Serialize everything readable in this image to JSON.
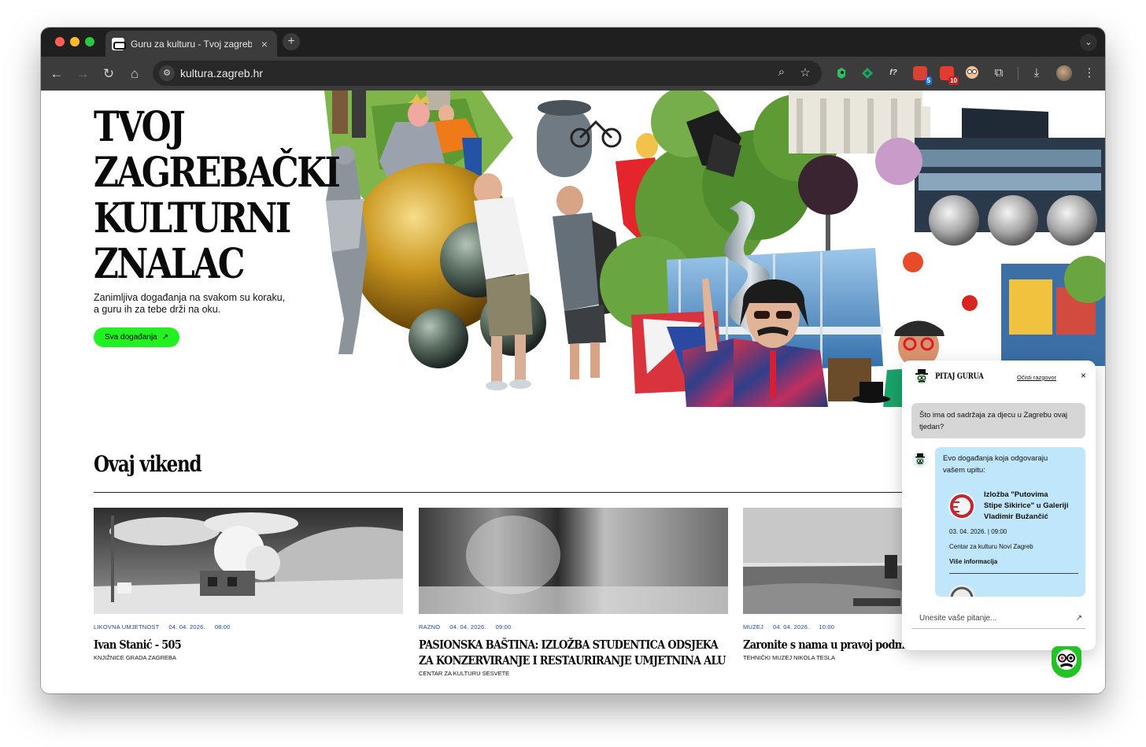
{
  "browser": {
    "tab_title": "Guru za kulturu - Tvoj zagreb",
    "tab_close": "×",
    "new_tab": "+",
    "tab_menu": "⌄",
    "url": "kultura.zagreb.hr",
    "extensions": [
      {
        "name": "evernote-icon",
        "color": "#2dbe60"
      },
      {
        "name": "diamond-extension-icon",
        "color": "#1fa463"
      },
      {
        "name": "formula-extension-icon",
        "color": "#3c3c3c",
        "label": "f?"
      },
      {
        "name": "todoist-extension-icon",
        "color": "#db4035",
        "badge": "5",
        "badge_color": "#1a73e8"
      },
      {
        "name": "calendar-extension-icon",
        "color": "#e23b2f",
        "badge": "10",
        "badge_color": "#c5221f"
      }
    ]
  },
  "hero": {
    "title_lines": [
      "TVOJ",
      "ZAGREBAČKI",
      "KULTURNI",
      "ZNALAC"
    ],
    "subtitle_lines": [
      "Zanimljiva događanja na svakom su koraku,",
      "a guru ih za tebe drži na oku."
    ],
    "cta_label": "Sva događanja",
    "cta_arrow": "↗"
  },
  "weekend": {
    "title": "Ovaj vikend",
    "events": [
      {
        "category": "LIKOVNA UMJETNOST",
        "date": "04. 04. 2026.",
        "time": "08:00",
        "title": "Ivan Stanić - 505",
        "venue": "KNJIŽNICE GRADA ZAGREBA"
      },
      {
        "category": "RAZNO",
        "date": "04. 04. 2026.",
        "time": "09:00",
        "title": "PASIONSKA BAŠTINA: IZLOŽBA STUDENTICA ODSJEKA ZA KONZERVIRANJE I RESTAURIRANJE UMJETNINA ALU",
        "venue": "CENTAR ZA KULTURU SESVETE"
      },
      {
        "category": "MUZEJ",
        "date": "04. 04. 2026.",
        "time": "10:00",
        "title": "Zaronite s nama u pravoj podmornici",
        "venue": "TEHNIČKI MUZEJ NIKOLA TESLA"
      }
    ]
  },
  "chat": {
    "title": "PITAJ GURUA",
    "clear_label": "Očisti razgovor",
    "close": "×",
    "user_message": "Što ima od sadržaja za djecu u Zagrebu ovaj tjedan?",
    "bot_intro_lines": [
      "Evo događanja koja odgovaraju",
      "vašem upitu:"
    ],
    "event": {
      "name_lines": [
        "Izložba \"Putovima",
        "Stipe Sikirice\" u Galeriji",
        "Vladimir Bužančić"
      ],
      "datetime": "03. 04. 2026. | 09:00",
      "venue": "Centar za kulturu Novi Zagreb",
      "more": "Više informacija"
    },
    "input_placeholder": "Unesite vaše pitanje...",
    "send_icon": "↗"
  }
}
